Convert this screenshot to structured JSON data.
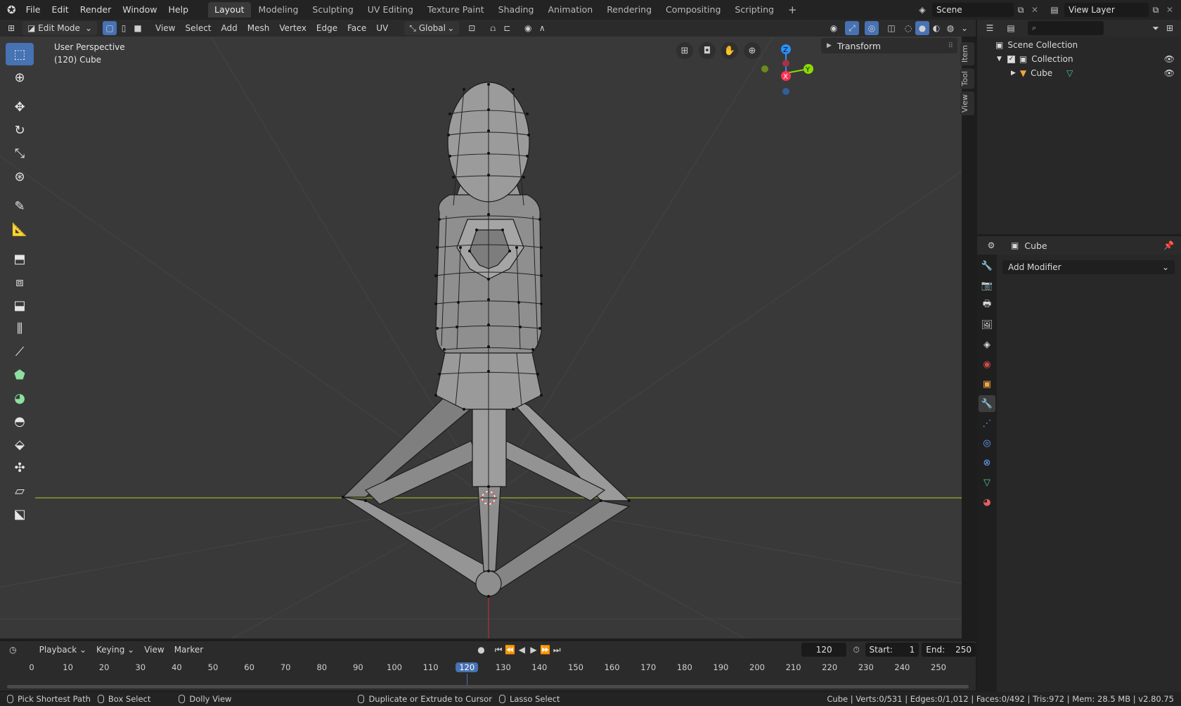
{
  "menu": [
    "File",
    "Edit",
    "Render",
    "Window",
    "Help"
  ],
  "workspaces": [
    {
      "label": "Layout",
      "active": true
    },
    {
      "label": "Modeling",
      "active": false
    },
    {
      "label": "Sculpting",
      "active": false
    },
    {
      "label": "UV Editing",
      "active": false
    },
    {
      "label": "Texture Paint",
      "active": false
    },
    {
      "label": "Shading",
      "active": false
    },
    {
      "label": "Animation",
      "active": false
    },
    {
      "label": "Rendering",
      "active": false
    },
    {
      "label": "Compositing",
      "active": false
    },
    {
      "label": "Scripting",
      "active": false
    }
  ],
  "add_workspace": "+",
  "scene_field": "Scene",
  "view_layer_field": "View Layer",
  "viewport_header": {
    "mode": "Edit Mode",
    "menus": [
      "View",
      "Select",
      "Add",
      "Mesh",
      "Vertex",
      "Edge",
      "Face",
      "UV"
    ],
    "orientation": "Global"
  },
  "viewport": {
    "perspective_label": "User Perspective",
    "object_label": "(120) Cube",
    "transform_panel": "Transform",
    "side_tabs": [
      "Item",
      "Tool",
      "View"
    ],
    "gizmo": {
      "z": "Z",
      "y": "Y",
      "x": "X"
    }
  },
  "outliner": {
    "scene_collection": "Scene Collection",
    "collection": "Collection",
    "cube": "Cube"
  },
  "properties": {
    "object_name": "Cube",
    "add_modifier": "Add Modifier"
  },
  "timeline": {
    "menus": [
      "Playback",
      "Keying",
      "View",
      "Marker"
    ],
    "current_frame": "120",
    "start_label": "Start:",
    "start_value": "1",
    "end_label": "End:",
    "end_value": "250",
    "ticks": [
      "0",
      "10",
      "20",
      "30",
      "40",
      "50",
      "60",
      "70",
      "80",
      "90",
      "100",
      "110",
      "120",
      "130",
      "140",
      "150",
      "160",
      "170",
      "180",
      "190",
      "200",
      "210",
      "220",
      "230",
      "240",
      "250"
    ]
  },
  "status": {
    "items": [
      "Pick Shortest Path",
      "Box Select",
      "Dolly View",
      "Duplicate or Extrude to Cursor",
      "Lasso Select"
    ],
    "stats": "Cube | Verts:0/531 | Edges:0/1,012 | Faces:0/492 | Tris:972 | Mem: 28.5 MB | v2.80.75"
  },
  "colors": {
    "accent": "#4772b3",
    "axis_x": "#ff3352",
    "axis_y": "#8bdc00",
    "axis_z": "#2890ff",
    "horizon_line": "#8b9a2c"
  }
}
